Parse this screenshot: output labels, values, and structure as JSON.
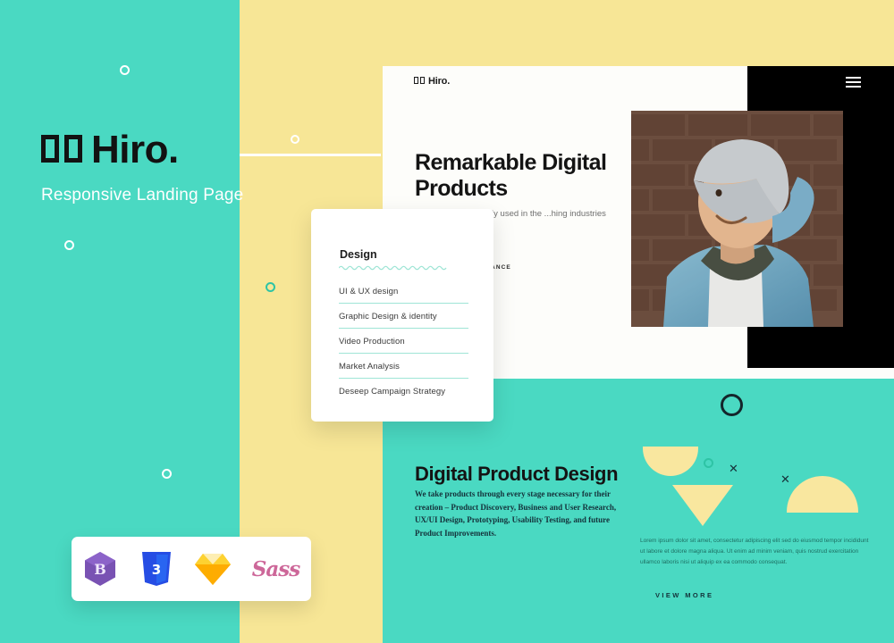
{
  "colors": {
    "teal": "#4ad9c2",
    "yellow": "#f7e696",
    "shape_yellow": "#f9e79f",
    "black": "#000000",
    "white": "#ffffff",
    "ink": "#141414",
    "sass_pink": "#cd6799",
    "bootstrap_purple": "#7952b3",
    "css3_blue": "#264de4",
    "sketch_orange": "#fdad00"
  },
  "hero": {
    "logo_glyphs": [
      "tofu",
      "tofu"
    ],
    "logo_text": "Hiro.",
    "subtitle": "Responsive Landing Page"
  },
  "browser_mock": {
    "logo_text": "Hiro.",
    "menu_icon": "hamburger-menu-icon",
    "headline": "Remarkable Digital Products",
    "body": "...older text commonly used in the ...hing industries for.",
    "social": [
      "BEHANCE"
    ],
    "social_separator": "•",
    "photo_alt": "smiling-man-denim-jacket-beanie-brick-wall"
  },
  "design_card": {
    "title": "Design",
    "items": [
      "UI & UX design",
      "Graphic Design & identity",
      "Video Production",
      "Market Analysis",
      "Deseep Campaign Strategy"
    ]
  },
  "product_section": {
    "heading": "Digital Product Design",
    "body": "We take products through every stage necessary for their creation – Product Discovery, Business and User Research, UX/UI Design, Prototyping, Usability Testing, and future Product Improvements.",
    "side_body": "Lorem ipsum dolor sit amet, consectetur adipiscing elit sed do eiusmod tempor incididunt ut labore et dolore magna aliqua. Ut enim ad minim veniam, quis nostrud exercitation ullamco laboris nisi ut aliquip ex ea commodo consequat.",
    "cta_label": "VIEW MORE"
  },
  "tech_badges": [
    {
      "name": "bootstrap-icon",
      "label": "Bootstrap"
    },
    {
      "name": "css3-icon",
      "label": "CSS3"
    },
    {
      "name": "sketch-icon",
      "label": "Sketch"
    },
    {
      "name": "sass-icon",
      "label": "Sass"
    }
  ]
}
